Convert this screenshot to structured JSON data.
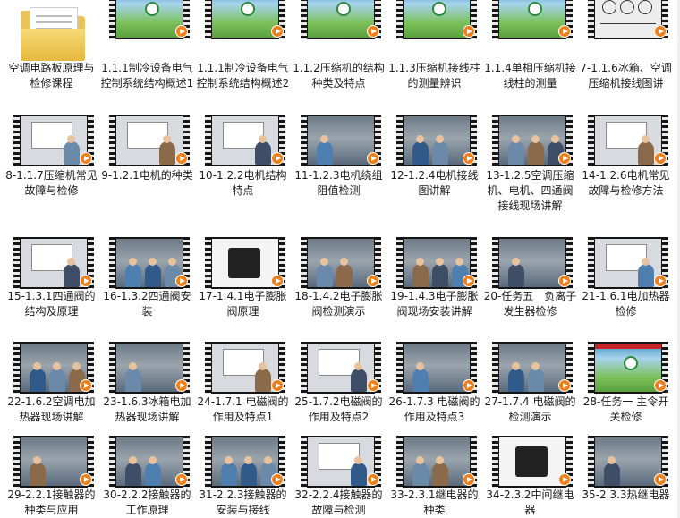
{
  "folder": {
    "label": "空调电路板原理与检修课程"
  },
  "videos": [
    {
      "label": "1.1.1制冷设备电气控制系统结构概述1",
      "style": "slide"
    },
    {
      "label": "1.1.1制冷设备电气控制系统结构概述2",
      "style": "slide"
    },
    {
      "label": "1.1.2压缩机的结构种类及特点",
      "style": "slide"
    },
    {
      "label": "1.1.3压缩机接线柱的测量辨识",
      "style": "slide"
    },
    {
      "label": "1.1.4单相压缩机接线柱的测量",
      "style": "slide"
    },
    {
      "label": "7-1.1.6冰箱、空调压缩机接线图讲",
      "style": "schem"
    },
    {
      "label": "8-1.1.7压缩机常见故障与检修",
      "style": "screen"
    },
    {
      "label": "9-1.2.1电机的种类",
      "style": "screen"
    },
    {
      "label": "10-1.2.2电机结构特点",
      "style": "screen"
    },
    {
      "label": "11-1.2.3电机绕组阻值检测",
      "style": "scene"
    },
    {
      "label": "12-1.2.4电机接线图讲解",
      "style": "scene"
    },
    {
      "label": "13-1.2.5空调压缩机、电机、四通阀接线现场讲解",
      "style": "scene"
    },
    {
      "label": "14-1.2.6电机常见故障与检修方法",
      "style": "screen"
    },
    {
      "label": "15-1.3.1四通阀的结构及原理",
      "style": "screen"
    },
    {
      "label": "16-1.3.2四通阀安装",
      "style": "scene"
    },
    {
      "label": "17-1.4.1电子膨胀阀原理",
      "style": "white"
    },
    {
      "label": "18-1.4.2电子膨胀阀检测演示",
      "style": "scene"
    },
    {
      "label": "19-1.4.3电子膨胀阀现场安装讲解",
      "style": "scene"
    },
    {
      "label": "20-任务五　负离子发生器检修",
      "style": "scene"
    },
    {
      "label": "21-1.6.1电加热器检修",
      "style": "screen"
    },
    {
      "label": "22-1.6.2空调电加热器现场讲解",
      "style": "scene"
    },
    {
      "label": "23-1.6.3冰箱电加热器现场讲解",
      "style": "scene"
    },
    {
      "label": "24-1.7.1 电磁阀的作用及特点1",
      "style": "screen"
    },
    {
      "label": "25-1.7.2电磁阀的作用及特点2",
      "style": "screen"
    },
    {
      "label": "26-1.7.3 电磁阀的作用及特点3",
      "style": "scene"
    },
    {
      "label": "27-1.7.4 电磁阀的检测演示",
      "style": "scene"
    },
    {
      "label": "28-任务一 主令开关检修",
      "style": "slide"
    },
    {
      "label": "29-2.2.1接触器的种类与应用",
      "style": "scene"
    },
    {
      "label": "30-2.2.2接触器的工作原理",
      "style": "scene"
    },
    {
      "label": "31-2.2.3接触器的安装与接线",
      "style": "scene"
    },
    {
      "label": "32-2.2.4接触器的故障与检测",
      "style": "screen"
    },
    {
      "label": "33-2.3.1继电器的种类",
      "style": "scene"
    },
    {
      "label": "34-2.3.2中间继电器",
      "style": "white"
    },
    {
      "label": "35-2.3.3热继电器",
      "style": "scene"
    }
  ]
}
